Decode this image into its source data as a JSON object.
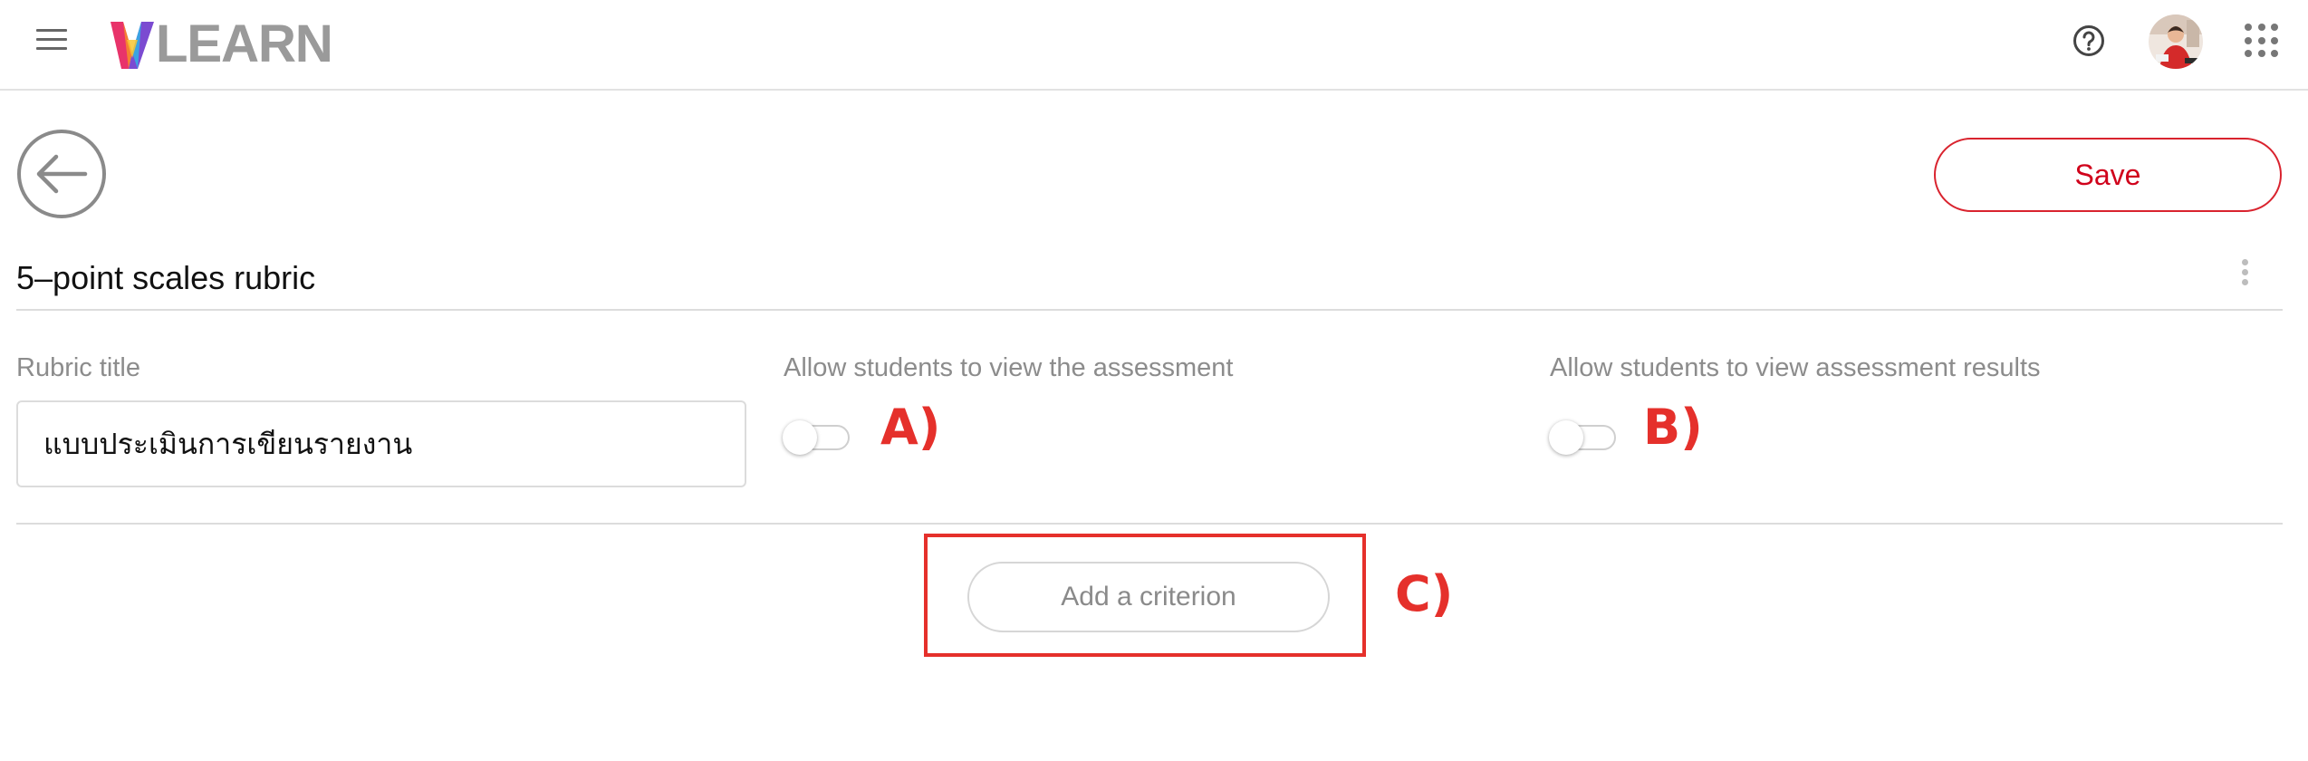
{
  "header": {
    "menu_icon": "hamburger-menu-icon",
    "logo_text": "LEARN",
    "logo_icon": "v-logo-mark",
    "help_icon": "question-circle-icon",
    "apps_icon": "apps-grid-icon"
  },
  "toolbar": {
    "back_icon": "arrow-left-circle-icon",
    "save_label": "Save",
    "more_icon": "vertical-dots-icon"
  },
  "rubric": {
    "name": "5–point scales rubric",
    "title_label": "Rubric title",
    "title_value": "แบบประเมินการเขียนรายงาน",
    "view_assessment_label": "Allow students to view the assessment",
    "view_assessment_enabled": false,
    "view_results_label": "Allow students to view assessment results",
    "view_results_enabled": false,
    "add_criterion_label": "Add a criterion"
  },
  "annotations": {
    "a": "A)",
    "b": "B)",
    "c": "C)"
  },
  "colors": {
    "accent": "#d0021b",
    "annotation": "#e5302b",
    "muted_text": "#8c8c8c",
    "divider": "#dcdcdc"
  }
}
